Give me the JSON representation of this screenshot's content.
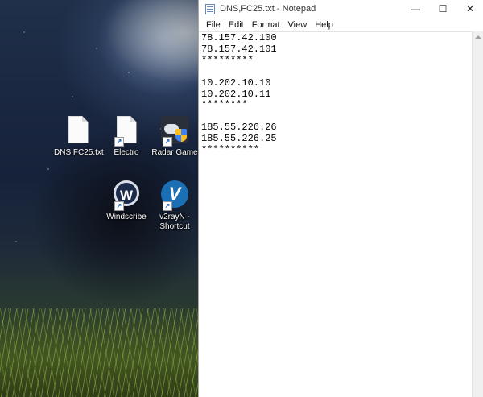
{
  "desktop": {
    "icons": [
      {
        "label": "DNS,FC25.txt",
        "icon": "text-file-icon"
      },
      {
        "label": "Electro",
        "icon": "blank-file-shortcut-icon"
      },
      {
        "label": "Radar Game",
        "icon": "gamepad-shield-icon"
      },
      {
        "label": "Windscribe",
        "icon": "windscribe-logo-icon"
      },
      {
        "label": "v2rayN -",
        "label2": "Shortcut",
        "icon": "v2rayn-logo-icon"
      }
    ]
  },
  "notepad": {
    "title": "DNS,FC25.txt - Notepad",
    "window_buttons": {
      "minimize": "—",
      "maximize": "☐",
      "close": "✕"
    },
    "menu": [
      "File",
      "Edit",
      "Format",
      "View",
      "Help"
    ],
    "content": "78.157.42.100\n78.157.42.101\n*********\n\n10.202.10.10\n10.202.10.11\n********\n\n185.55.226.26\n185.55.226.25\n**********"
  }
}
